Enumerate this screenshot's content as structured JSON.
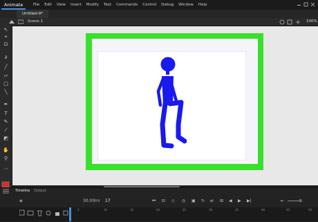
{
  "app": {
    "name": "Animate"
  },
  "menu": [
    "File",
    "Edit",
    "View",
    "Insert",
    "Modify",
    "Text",
    "Commands",
    "Control",
    "Debug",
    "Window",
    "Help"
  ],
  "document": {
    "tab_label": "Untitled-9*",
    "scene_label": "Scene 1",
    "zoom": "100%"
  },
  "colors": {
    "stroke": "#d32f2f",
    "fill": "#ffffff",
    "stage_frame": "#38e02c",
    "figure": "#1a1aee"
  },
  "timeline": {
    "tabs": [
      "Timeline",
      "Output"
    ],
    "fps": "30.00",
    "fps_unit": "FPS",
    "current_frame": "17",
    "ruler_labels": [
      "5",
      "10",
      "15",
      "20",
      "25",
      "30",
      "35",
      "40",
      "45",
      "50"
    ]
  }
}
